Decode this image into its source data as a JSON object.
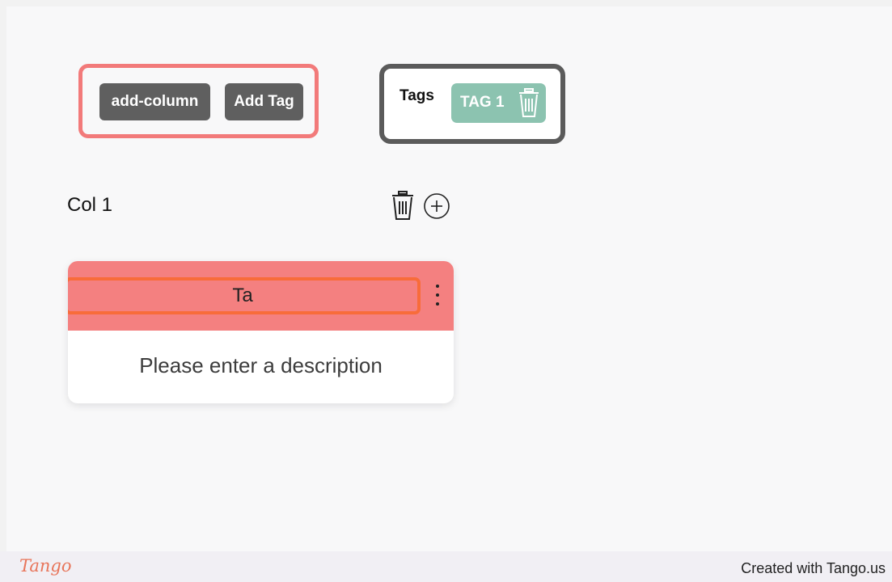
{
  "toolbar": {
    "add_column_label": "add-column",
    "add_tag_label": "Add Tag"
  },
  "tags_panel": {
    "label": "Tags",
    "tags": [
      {
        "label": "TAG 1",
        "color": "#8cc3b0"
      }
    ]
  },
  "column": {
    "title": "Col 1",
    "card": {
      "title_value": "Ta",
      "description": "Please enter a description",
      "header_color": "#f48080"
    }
  },
  "footer": {
    "logo": "Tango",
    "credit": "Created with Tango.us"
  },
  "colors": {
    "highlight_red": "#f27a7a",
    "highlight_dark": "#5b5b5b",
    "highlight_orange": "#f86c3a"
  }
}
